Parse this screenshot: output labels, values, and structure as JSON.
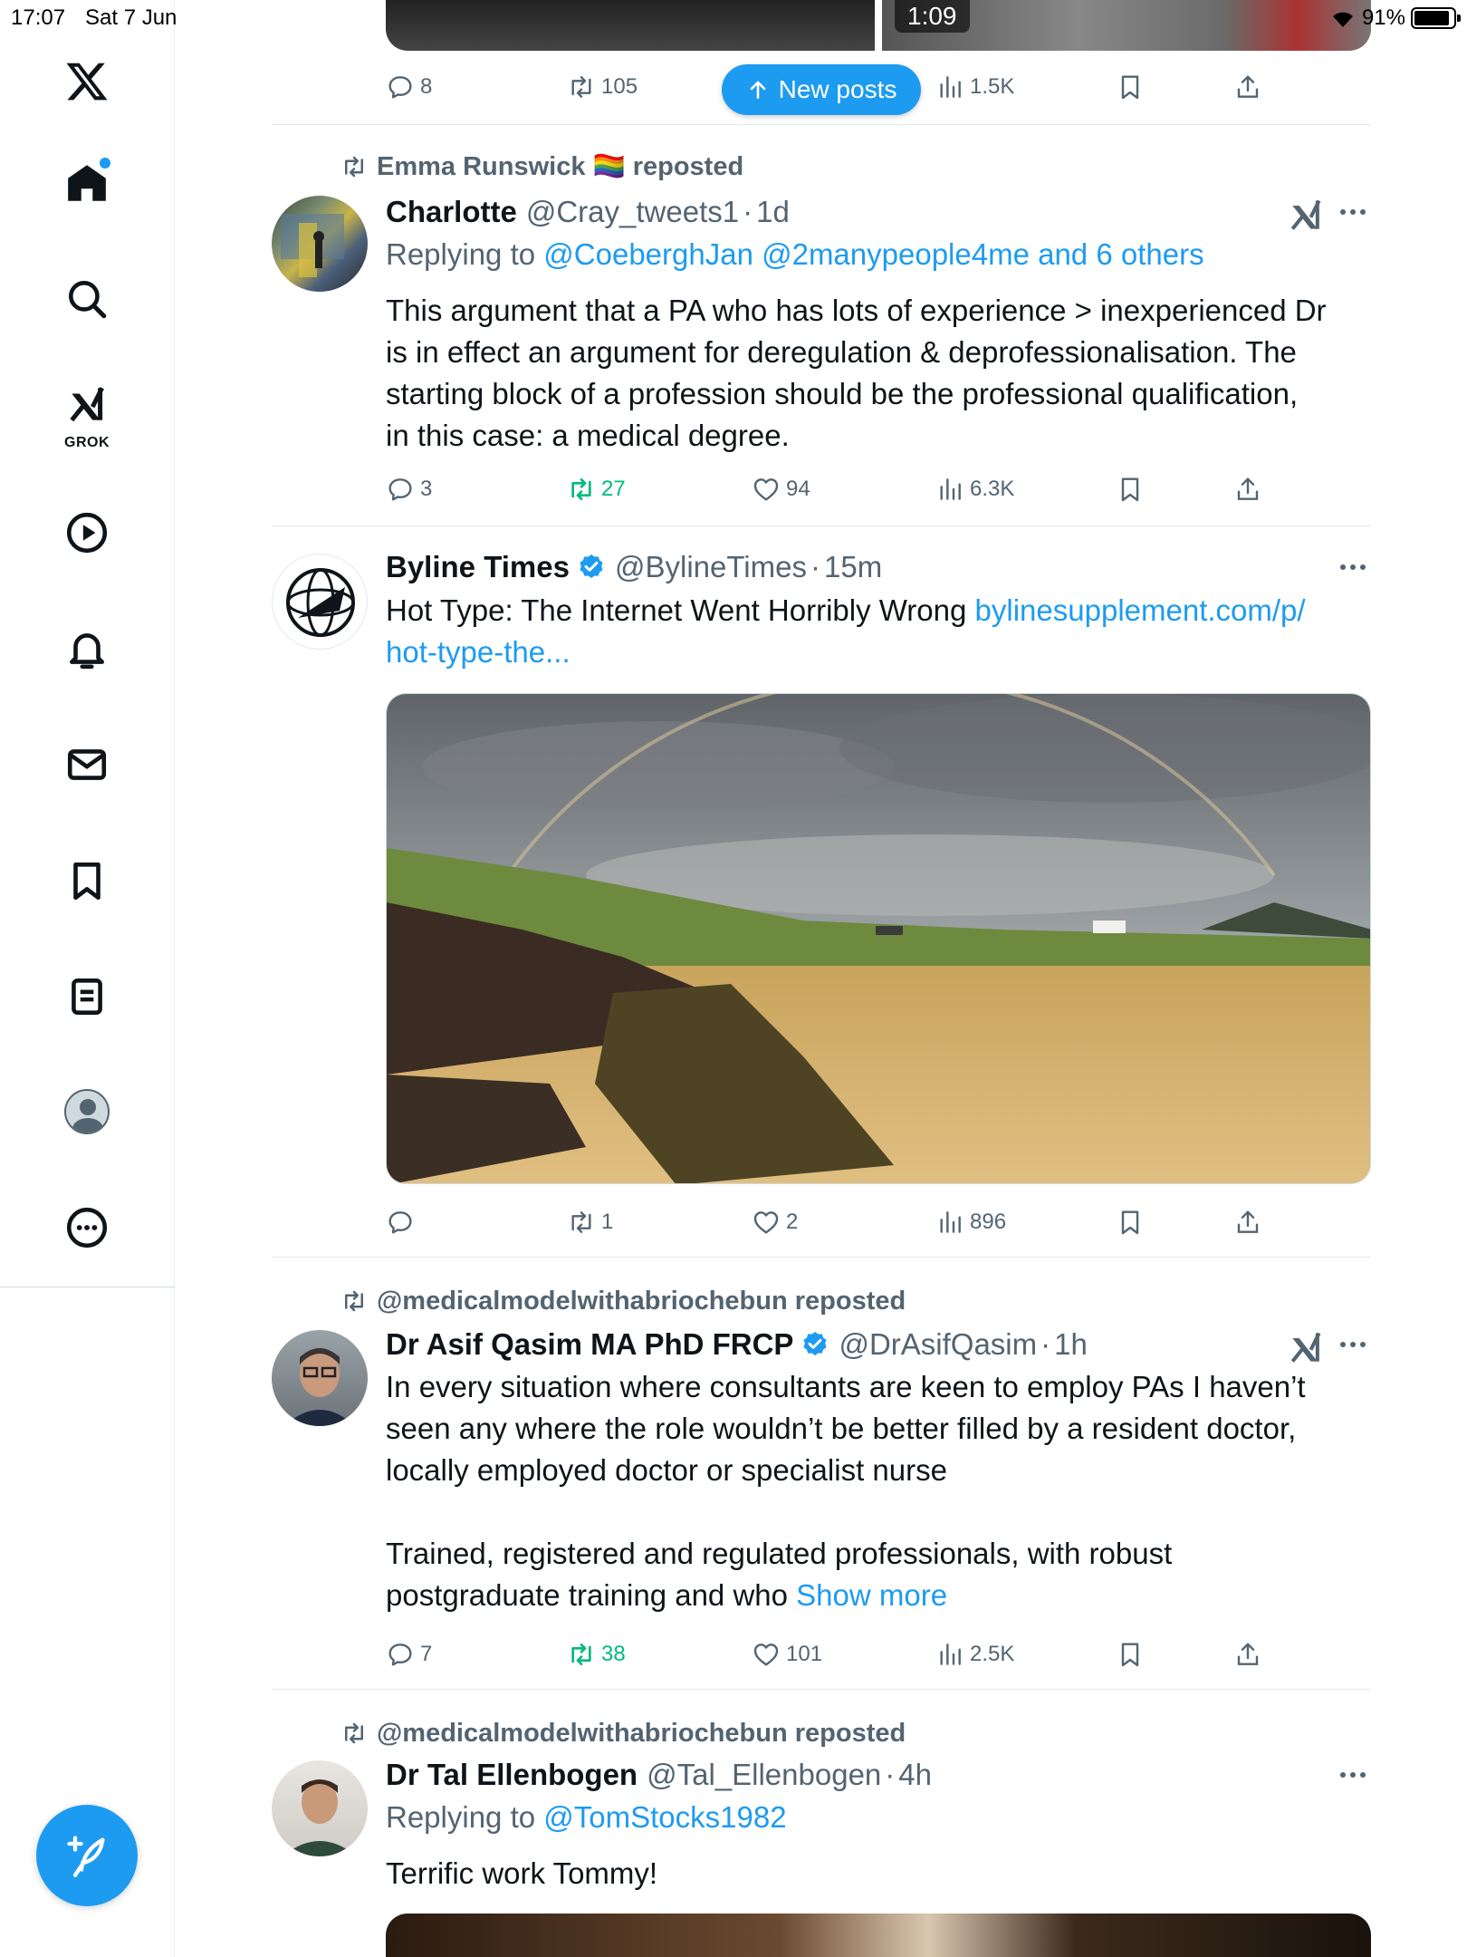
{
  "status_bar": {
    "time": "17:07",
    "date": "Sat 7 Jun",
    "battery": "91%"
  },
  "sidebar": {
    "grok_label": "GROK",
    "items": [
      {
        "name": "x-logo"
      },
      {
        "name": "home",
        "notification_dot": true
      },
      {
        "name": "explore"
      },
      {
        "name": "grok"
      },
      {
        "name": "video"
      },
      {
        "name": "notifications"
      },
      {
        "name": "messages"
      },
      {
        "name": "bookmarks"
      },
      {
        "name": "lists"
      },
      {
        "name": "profile"
      },
      {
        "name": "more"
      }
    ]
  },
  "new_posts": {
    "label": "New posts"
  },
  "top_tweet": {
    "media_duration": "1:09",
    "actions": {
      "replies": "8",
      "reposts": "105",
      "views": "1.5K"
    }
  },
  "tweets": [
    {
      "repost_by": "Emma Runswick 🏳️‍🌈 reposted",
      "name": "Charlotte",
      "handle": "@Cray_tweets1",
      "time": "1d",
      "replying_prefix": "Replying to",
      "replying_to": "@CoeberghJan @2manypeople4me and 6 others",
      "body": "This argument that a PA who has lots of experience > inexperienced Dr\nis in effect an argument for deregulation & deprofessionalisation. The\nstarting block of a profession should be the professional qualification,\nin this case: a medical degree.",
      "actions": {
        "replies": "3",
        "reposts": "27",
        "likes": "94",
        "views": "6.3K"
      }
    },
    {
      "name": "Byline Times",
      "handle": "@BylineTimes",
      "time": "15m",
      "body_text": "Hot Type: The Internet Went Horribly Wrong ",
      "body_link": "bylinesupplement.com/p/\nhot-type-the...",
      "actions": {
        "replies": "",
        "reposts": "1",
        "likes": "2",
        "views": "896"
      }
    },
    {
      "repost_by": "@medicalmodelwithabriochebun reposted",
      "name": "Dr Asif Qasim MA PhD FRCP",
      "handle": "@DrAsifQasim",
      "time": "1h",
      "body": "In every situation where consultants are keen to employ PAs I haven’t\nseen any where the role wouldn’t be better filled by a resident doctor,\nlocally employed doctor or specialist nurse\n\nTrained, registered and regulated professionals, with robust\npostgraduate training and who ",
      "show_more": "Show more",
      "actions": {
        "replies": "7",
        "reposts": "38",
        "likes": "101",
        "views": "2.5K"
      }
    },
    {
      "repost_by": "@medicalmodelwithabriochebun reposted",
      "name": "Dr Tal Ellenbogen",
      "handle": "@Tal_Ellenbogen",
      "time": "4h",
      "replying_prefix": "Replying to",
      "replying_to": "@TomStocks1982",
      "body": "Terrific work Tommy!"
    }
  ],
  "colors": {
    "accent": "#1d9bf0",
    "text": "#0f1419",
    "muted": "#536471",
    "repost_green": "#00ba7c"
  }
}
